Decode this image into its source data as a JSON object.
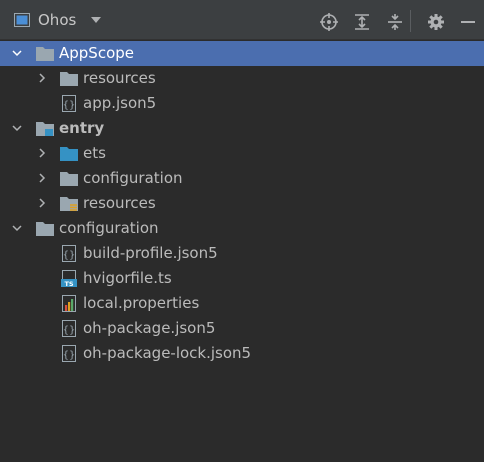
{
  "toolbar": {
    "title": "Ohos",
    "view_icon": "project-view-icon",
    "dropdown_icon": "chevron-down-icon",
    "actions": [
      "locate-icon",
      "expand-all-icon",
      "collapse-all-icon",
      "gear-icon",
      "minimize-icon"
    ]
  },
  "colors": {
    "background": "#2b2b2b",
    "toolbar": "#3c3f41",
    "selection": "#4b6eaf",
    "folder": "#9aa7b0",
    "ets_folder": "#3592c4",
    "text": "#bbbbbb"
  },
  "tree": [
    {
      "label": "AppScope",
      "type": "folder",
      "expanded": true,
      "selected": true
    },
    {
      "label": "resources",
      "type": "folder",
      "expanded": false
    },
    {
      "label": "app.json5",
      "type": "json5"
    },
    {
      "label": "entry",
      "type": "module",
      "expanded": true,
      "bold": true
    },
    {
      "label": "ets",
      "type": "source-folder",
      "expanded": false
    },
    {
      "label": "configuration",
      "type": "folder",
      "expanded": false
    },
    {
      "label": "resources",
      "type": "resources-folder",
      "expanded": false
    },
    {
      "label": "configuration",
      "type": "folder",
      "expanded": true
    },
    {
      "label": "build-profile.json5",
      "type": "json5"
    },
    {
      "label": "hvigorfile.ts",
      "type": "ts"
    },
    {
      "label": "local.properties",
      "type": "properties"
    },
    {
      "label": "oh-package.json5",
      "type": "json5"
    },
    {
      "label": "oh-package-lock.json5",
      "type": "json5"
    }
  ]
}
